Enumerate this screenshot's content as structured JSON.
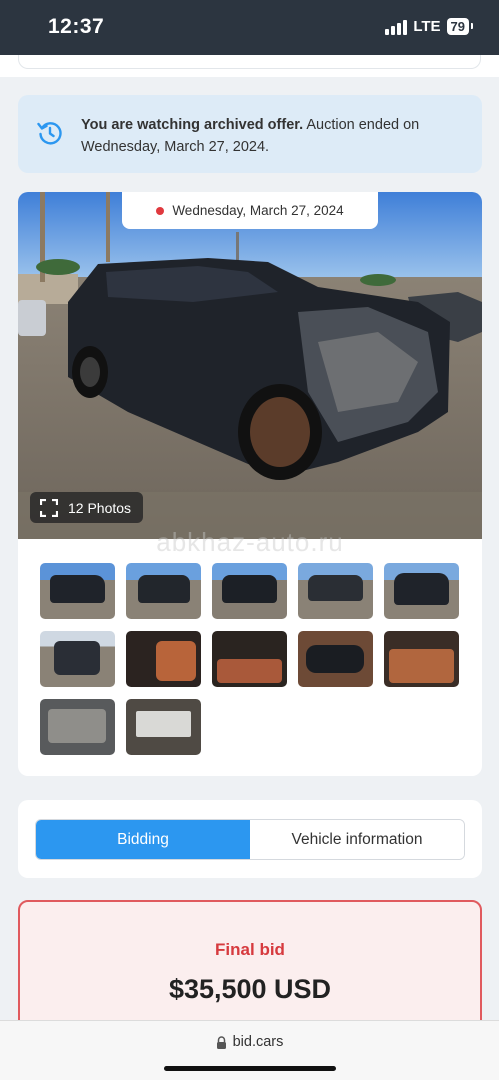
{
  "status_bar": {
    "time": "12:37",
    "network": "LTE",
    "battery": "79"
  },
  "archived_notice": {
    "bold_text": "You are watching archived offer.",
    "rest_text": " Auction ended on Wednesday, March 27, 2024.",
    "icon": "history-icon"
  },
  "gallery": {
    "date": "Wednesday, March 27, 2024",
    "photos_label": "12 Photos",
    "watermark": "abkhaz-auto.ru",
    "thumbnail_count": 12
  },
  "tabs": {
    "bidding": "Bidding",
    "vehicle_info": "Vehicle information",
    "active": "bidding"
  },
  "bid": {
    "label": "Final bid",
    "amount": "$35,500 USD"
  },
  "browser": {
    "url": "bid.cars"
  },
  "colors": {
    "accent_blue": "#2c97f0",
    "final_bid_red": "#d63a3e",
    "notice_bg": "#ddebf7"
  }
}
